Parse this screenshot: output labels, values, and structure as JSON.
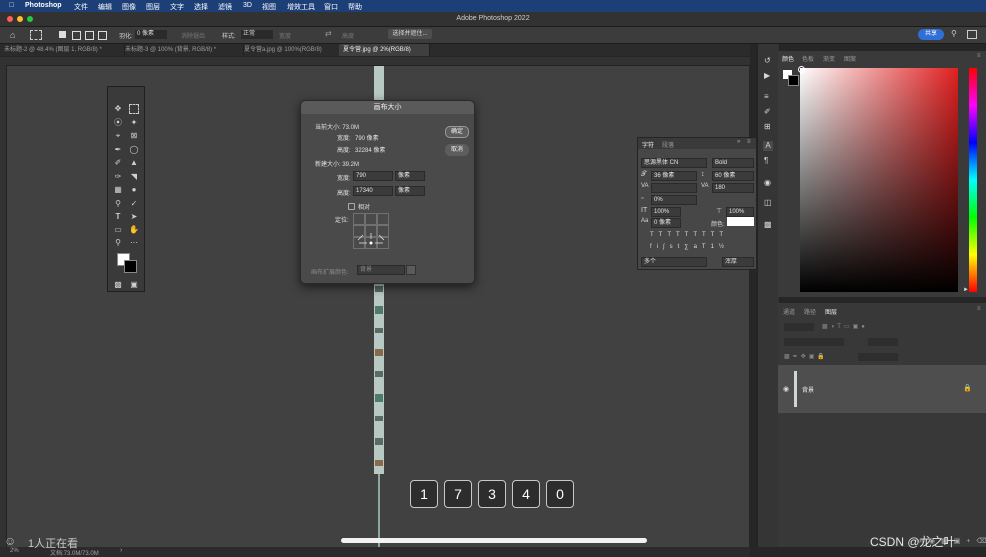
{
  "menubar": {
    "app_name": "Photoshop",
    "items": [
      "文件",
      "编辑",
      "图像",
      "图层",
      "文字",
      "选择",
      "滤镜",
      "3D",
      "视图",
      "增效工具",
      "窗口",
      "帮助"
    ]
  },
  "window": {
    "title": "Adobe Photoshop 2022"
  },
  "options_bar": {
    "feather_label": "羽化:",
    "feather_value": "0 像素",
    "antialias": "消除锯齿",
    "style_label": "样式:",
    "style_value": "正常",
    "width_label": "宽度",
    "height_label": "高度",
    "select_mask_button": "选择并遮住...",
    "share_button": "共享"
  },
  "doc_tabs": [
    "未标题-2 @ 48.4% (图层 1, RGB/8) *",
    "未标题-3 @ 100% (背景, RGB/8) *",
    "夏令营a.jpg @ 100%(RGB/8)",
    "夏令营.jpg @ 2%(RGB/8)"
  ],
  "canvas_size_dialog": {
    "title": "画布大小",
    "current_size_label": "当前大小: 73.0M",
    "current_width_label": "宽度:",
    "current_width_value": "790 像素",
    "current_height_label": "高度:",
    "current_height_value": "32284 像素",
    "new_size_label": "新建大小: 39.2M",
    "new_width_label": "宽度:",
    "new_width_value": "790",
    "new_width_unit": "像素",
    "new_height_label": "高度:",
    "new_height_value": "17340",
    "new_height_unit": "像素",
    "relative_label": "相对",
    "anchor_label": "定位:",
    "ext_color_label": "画布扩展颜色:",
    "ext_color_value": "背景",
    "ok_button": "确定",
    "cancel_button": "取消"
  },
  "character_panel": {
    "tabs": [
      "字符",
      "段落"
    ],
    "font_family": "思源黑体 CN",
    "font_style": "Bold",
    "font_size": "36 像素",
    "leading": "60 像素",
    "kerning": "",
    "tracking": "180",
    "scale_percent": "0%",
    "vertical_scale": "100%",
    "horizontal_scale": "100%",
    "baseline_shift": "0 像素",
    "color_label": "颜色:",
    "language": "多个",
    "aa_method": "浑厚"
  },
  "color_panel": {
    "tabs": [
      "颜色",
      "色板",
      "渐变",
      "图案"
    ],
    "fg_color": "#ffffff",
    "bg_color": "#000000"
  },
  "layers_panel": {
    "tabs": [
      "通道",
      "路径",
      "图层"
    ],
    "layers": [
      {
        "name": "背景"
      }
    ]
  },
  "overlay": {
    "digits": [
      "1",
      "7",
      "3",
      "4",
      "0"
    ],
    "watching": "1人正在看",
    "watermark": "CSDN @龙之叶"
  },
  "status": {
    "zoom": "2%",
    "doc_info": "文档:73.0M/73.0M"
  }
}
